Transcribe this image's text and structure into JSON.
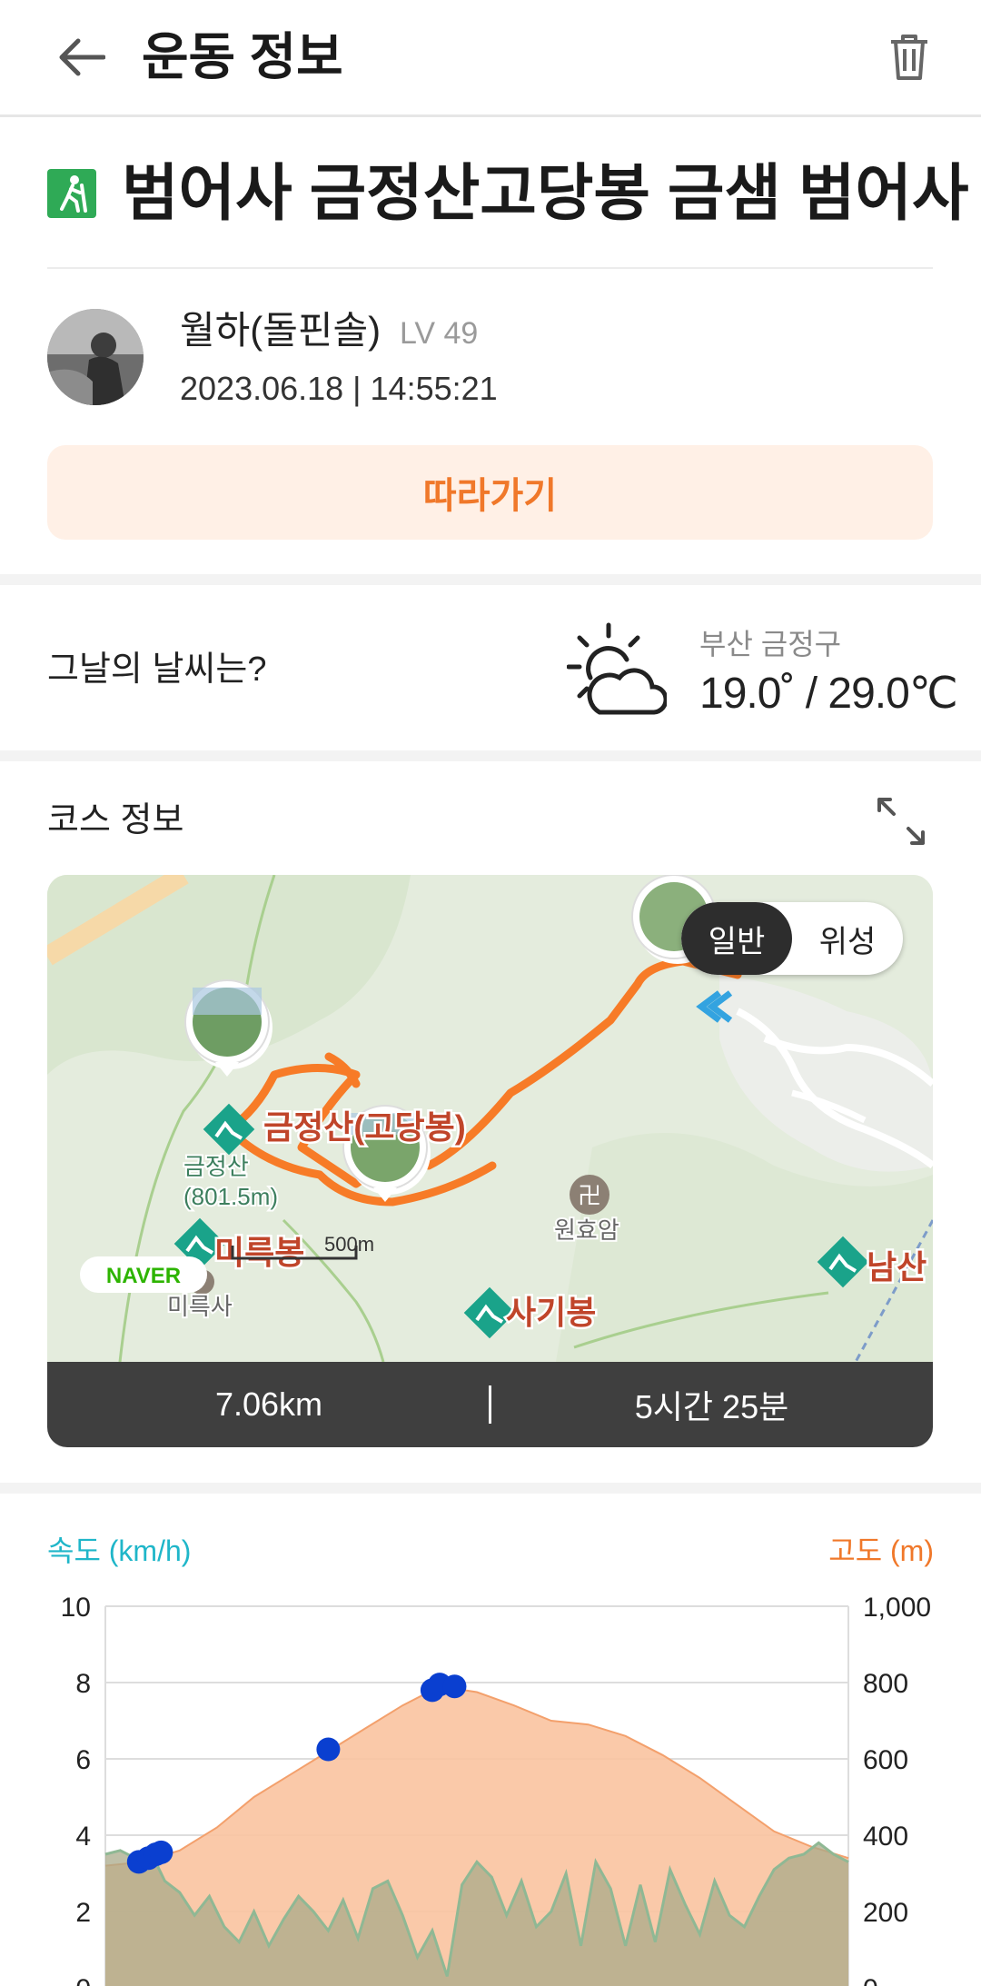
{
  "header": {
    "title": "운동 정보",
    "back_icon": "arrow-left-icon",
    "trash_icon": "trash-icon"
  },
  "workout": {
    "title": "범어사 금정산고당봉 금샘 범어사",
    "activity_icon": "hiking-icon",
    "activity_color": "#2faa56"
  },
  "author": {
    "name": "월하(돌핀솔)",
    "level": "LV 49",
    "datetime": "2023.06.18 | 14:55:21"
  },
  "follow_button": {
    "label": "따라가기",
    "bg": "#fff0e6",
    "color": "#f0782a"
  },
  "weather": {
    "question": "그날의 날씨는?",
    "icon": "partly-cloudy-icon",
    "location": "부산 금정구",
    "temp": "19.0˚ / 29.0℃"
  },
  "course": {
    "label": "코스 정보",
    "expand_icon": "expand-icon",
    "map": {
      "toggle": [
        "일반",
        "위성"
      ],
      "selected": "일반",
      "route_color": "#f77b27",
      "labels": {
        "peak_main": "금정산(고당봉)",
        "peak_small": "금정산",
        "peak_elev": "(801.5m)",
        "mireukbong": "미륵봉",
        "mireuksa": "미륵사",
        "wonhyoam": "원효암",
        "sagibong": "사기봉",
        "namsan": "남산",
        "scale": "500m",
        "naver": "NAVER"
      }
    },
    "stats": {
      "distance": "7.06km",
      "duration": "5시간 25분"
    }
  },
  "chart_data": {
    "type": "area",
    "left_axis": {
      "label": "속도 (km/h)",
      "ticks": [
        "10",
        "8",
        "6",
        "4",
        "2",
        "0"
      ],
      "range": [
        0,
        10
      ],
      "color": "#1fb6c9"
    },
    "right_axis": {
      "label": "고도 (m)",
      "ticks": [
        "1,000",
        "800",
        "600",
        "400",
        "200",
        "0"
      ],
      "range": [
        0,
        1000
      ],
      "color": "#f0782a"
    },
    "altitude_series": {
      "x": [
        0,
        0.05,
        0.1,
        0.15,
        0.2,
        0.25,
        0.3,
        0.35,
        0.4,
        0.45,
        0.5,
        0.55,
        0.6,
        0.65,
        0.7,
        0.75,
        0.8,
        0.85,
        0.9,
        0.95,
        1.0
      ],
      "values": [
        320,
        330,
        360,
        420,
        500,
        560,
        620,
        680,
        740,
        790,
        775,
        740,
        700,
        690,
        660,
        610,
        550,
        480,
        410,
        370,
        340
      ],
      "color": "#f9c3a0"
    },
    "speed_series": {
      "x": [
        0,
        0.02,
        0.04,
        0.06,
        0.08,
        0.1,
        0.12,
        0.14,
        0.16,
        0.18,
        0.2,
        0.22,
        0.24,
        0.26,
        0.28,
        0.3,
        0.32,
        0.34,
        0.36,
        0.38,
        0.4,
        0.42,
        0.44,
        0.46,
        0.48,
        0.5,
        0.52,
        0.54,
        0.56,
        0.58,
        0.6,
        0.62,
        0.64,
        0.66,
        0.68,
        0.7,
        0.72,
        0.74,
        0.76,
        0.78,
        0.8,
        0.82,
        0.84,
        0.86,
        0.88,
        0.9,
        0.92,
        0.94,
        0.96,
        0.98,
        1.0
      ],
      "values": [
        3.5,
        3.6,
        3.4,
        3.6,
        2.8,
        2.5,
        1.9,
        2.4,
        1.6,
        1.2,
        2.0,
        1.1,
        1.8,
        2.4,
        2.0,
        1.5,
        2.3,
        1.3,
        2.6,
        2.8,
        1.9,
        0.8,
        1.5,
        0.3,
        2.7,
        3.3,
        2.9,
        1.9,
        2.8,
        1.6,
        2.0,
        3.0,
        1.1,
        3.3,
        2.6,
        1.1,
        2.7,
        1.2,
        3.1,
        2.2,
        1.4,
        2.8,
        1.9,
        1.6,
        2.4,
        3.1,
        3.4,
        3.5,
        3.8,
        3.5,
        3.3
      ],
      "color": "#8fb894"
    },
    "photo_markers_speed": [
      {
        "x": 0.045,
        "value": 3.3
      },
      {
        "x": 0.058,
        "value": 3.4
      },
      {
        "x": 0.068,
        "value": 3.5
      },
      {
        "x": 0.075,
        "value": 3.55
      },
      {
        "x": 0.3,
        "value": 6.25
      },
      {
        "x": 0.44,
        "value": 7.8
      },
      {
        "x": 0.45,
        "value": 7.95
      },
      {
        "x": 0.47,
        "value": 7.9
      }
    ],
    "marker_color": "#0a3fd0",
    "grid": true
  }
}
